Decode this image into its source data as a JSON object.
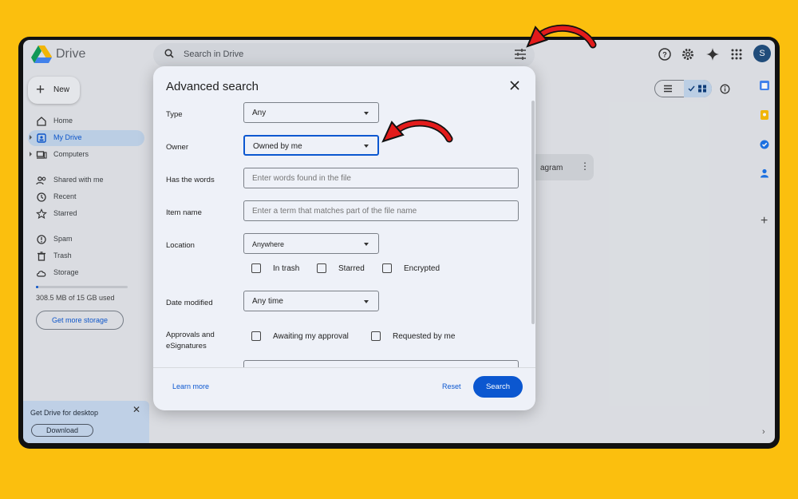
{
  "app": {
    "name": "Drive",
    "search_placeholder": "Search in Drive",
    "avatar_letter": "S"
  },
  "toolbar": {
    "new_label": "New"
  },
  "sidebar": {
    "items": [
      {
        "label": "Home",
        "icon": "home-icon"
      },
      {
        "label": "My Drive",
        "icon": "my-drive-icon",
        "active": true
      },
      {
        "label": "Computers",
        "icon": "computers-icon"
      },
      {
        "label": "Shared with me",
        "icon": "shared-icon"
      },
      {
        "label": "Recent",
        "icon": "clock-icon"
      },
      {
        "label": "Starred",
        "icon": "star-icon"
      },
      {
        "label": "Spam",
        "icon": "spam-icon"
      },
      {
        "label": "Trash",
        "icon": "trash-icon"
      },
      {
        "label": "Storage",
        "icon": "cloud-icon"
      }
    ],
    "storage_used_fraction": 0.02,
    "storage_text": "308.5 MB of 15 GB used",
    "get_storage_label": "Get more storage"
  },
  "promo": {
    "text": "Get Drive for desktop",
    "download_label": "Download"
  },
  "file": {
    "partial_name": "agram"
  },
  "modal": {
    "title": "Advanced search",
    "type": {
      "label": "Type",
      "value": "Any"
    },
    "owner": {
      "label": "Owner",
      "value": "Owned by me"
    },
    "has_words": {
      "label": "Has the words",
      "placeholder": "Enter words found in the file"
    },
    "item_name": {
      "label": "Item name",
      "placeholder": "Enter a term that matches part of the file name"
    },
    "location": {
      "label": "Location",
      "value": "Anywhere",
      "checkboxes": [
        "In trash",
        "Starred",
        "Encrypted"
      ]
    },
    "date_modified": {
      "label": "Date modified",
      "value": "Any time"
    },
    "approvals": {
      "label_line1": "Approvals and",
      "label_line2": "eSignatures",
      "checkboxes": [
        "Awaiting my approval",
        "Requested by me"
      ]
    },
    "learn_more": "Learn more",
    "reset": "Reset",
    "search": "Search"
  },
  "colors": {
    "accent": "#0b57d0",
    "annotation_arrow": "#e31b1b",
    "background": "#FBBF0E"
  }
}
